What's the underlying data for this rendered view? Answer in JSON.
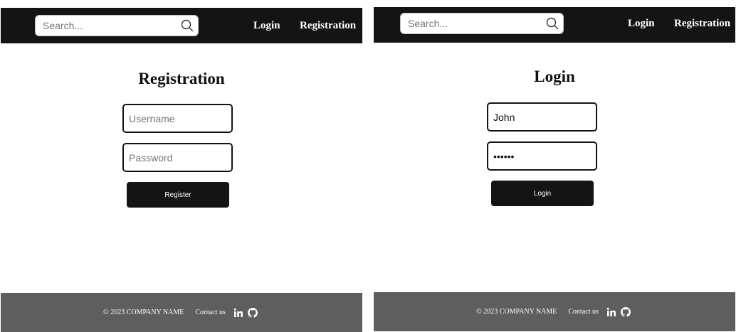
{
  "left_panel": {
    "search": {
      "placeholder": "Search...",
      "value": ""
    },
    "nav": {
      "login_label": "Login",
      "registration_label": "Registration"
    },
    "form": {
      "title": "Registration",
      "username": {
        "placeholder": "Username",
        "value": ""
      },
      "password": {
        "placeholder": "Password",
        "value": ""
      },
      "submit_label": "Register"
    },
    "footer": {
      "copyright": "© 2023 COMPANY NAME",
      "contact_label": "Contact us",
      "icons": [
        "linkedin-icon",
        "github-icon"
      ]
    }
  },
  "right_panel": {
    "search": {
      "placeholder": "Search...",
      "value": ""
    },
    "nav": {
      "login_label": "Login",
      "registration_label": "Registration"
    },
    "form": {
      "title": "Login",
      "username": {
        "placeholder": "",
        "value": "John"
      },
      "password": {
        "placeholder": "",
        "value": "••••••"
      },
      "submit_label": "Login"
    },
    "footer": {
      "copyright": "© 2023 COMPANY NAME",
      "contact_label": "Contact us",
      "icons": [
        "linkedin-icon",
        "github-icon"
      ]
    }
  },
  "colors": {
    "navbar": "#141414",
    "footer": "#5e5e5f",
    "button": "#141414",
    "text_on_dark": "#ffffff"
  }
}
